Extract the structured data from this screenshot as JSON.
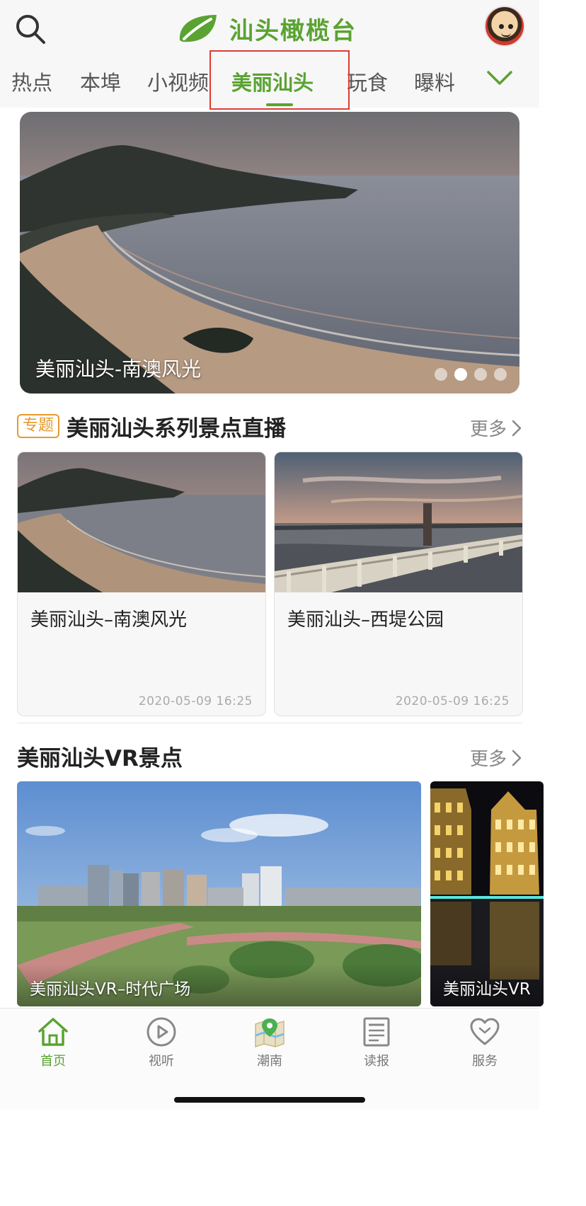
{
  "header": {
    "logo_text": "汕头橄榄台",
    "accent_color": "#5aa332",
    "icons": {
      "search": "search-icon",
      "avatar": "avatar",
      "logo": "leaf-logo-icon"
    }
  },
  "tabs": [
    {
      "label": "热点",
      "active": false
    },
    {
      "label": "本埠",
      "active": false
    },
    {
      "label": "小视频",
      "active": false
    },
    {
      "label": "美丽汕头",
      "active": true
    },
    {
      "label": "玩食",
      "active": false
    },
    {
      "label": "曝料",
      "active": false
    }
  ],
  "banner": {
    "caption": "美丽汕头-南澳风光",
    "dots_total": 4,
    "active_dot": 2
  },
  "section_special": {
    "tag": "专题",
    "title": "美丽汕头系列景点直播",
    "more": "更多"
  },
  "cards": [
    {
      "title": "美丽汕头–南澳风光",
      "time": "2020-05-09 16:25"
    },
    {
      "title": "美丽汕头–西堤公园",
      "time": "2020-05-09 16:25"
    }
  ],
  "section_vr": {
    "title": "美丽汕头VR景点",
    "more": "更多",
    "items": [
      {
        "caption": "美丽汕头VR–时代广场"
      },
      {
        "caption": "美丽汕头VR"
      }
    ]
  },
  "bottom_nav": [
    {
      "label": "首页",
      "icon": "home-icon",
      "active": true
    },
    {
      "label": "视听",
      "icon": "play-icon",
      "active": false
    },
    {
      "label": "潮南",
      "icon": "map-icon",
      "active": false
    },
    {
      "label": "读报",
      "icon": "newspaper-icon",
      "active": false
    },
    {
      "label": "服务",
      "icon": "heart-icon",
      "active": false
    }
  ]
}
